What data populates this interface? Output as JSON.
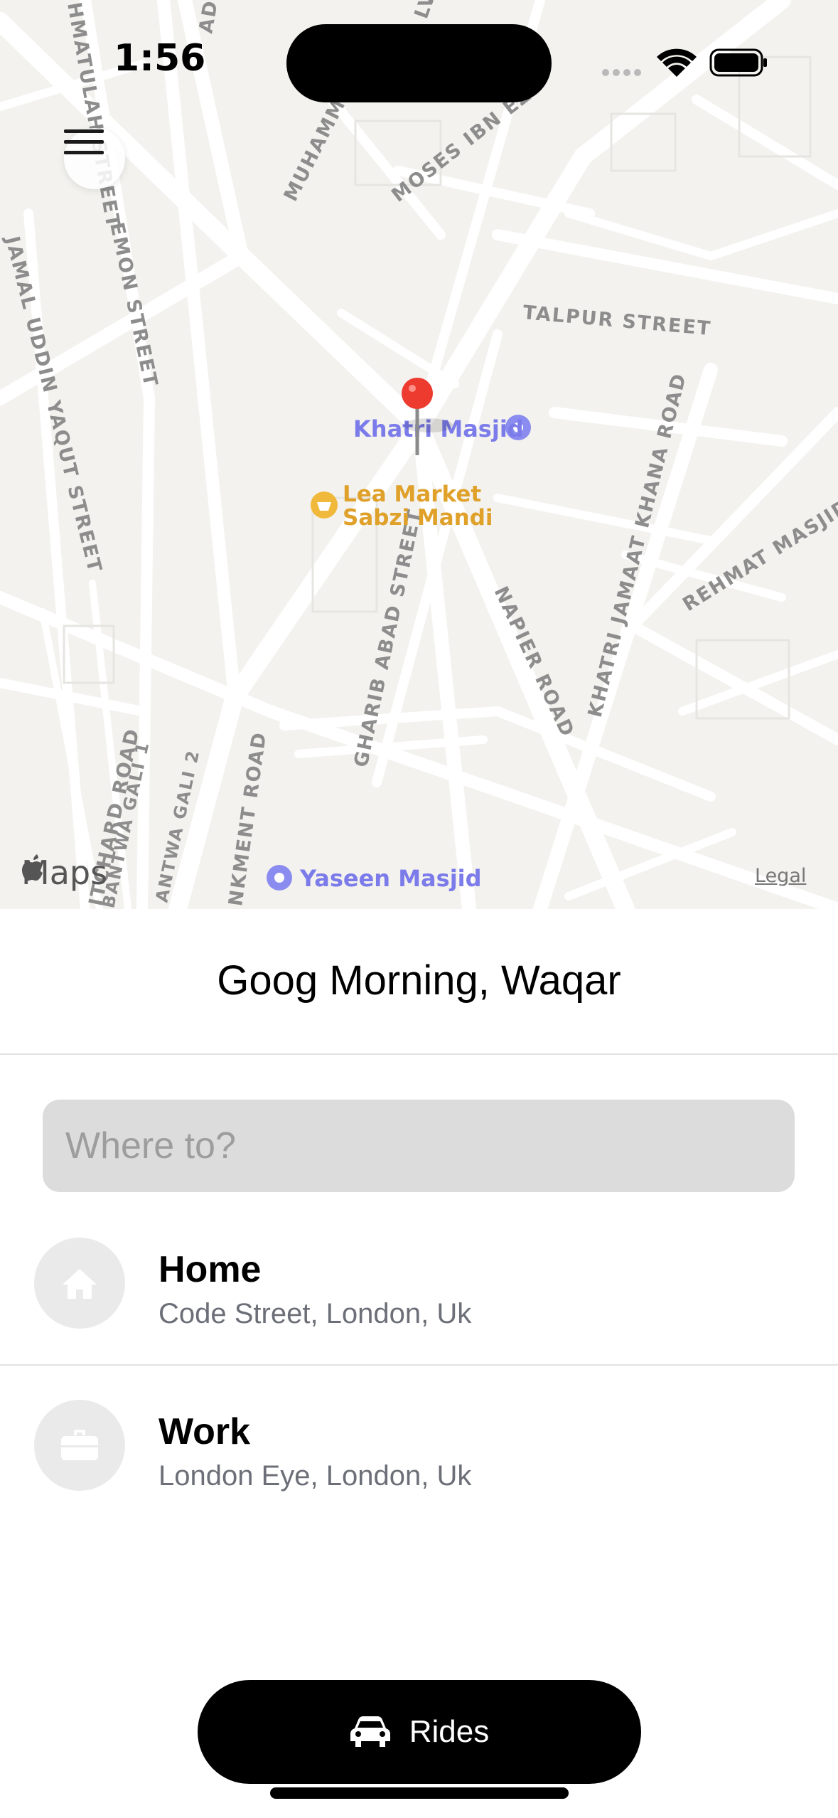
{
  "status_bar": {
    "time": "1:56"
  },
  "map": {
    "streets": [
      "MOSES IBN EZ",
      "TALPUR STREET",
      "KHATRI JAMAAT KHANA ROAD",
      "NAPIER ROAD",
      "GHARIB ABAD STREET",
      "REHMAT MASJID STREE",
      "JAMAL UDDIN YAQUT STREET",
      "EMON STREET",
      "HMATULAH STREET",
      "MUHAMM",
      "ITCHARD ROAD",
      "NKMENT ROAD",
      "BANTWA GALI 1",
      "ANTWA GALI 2",
      "AD",
      "LVA"
    ],
    "pois": {
      "khatri_masjid": "Khatri Masjid",
      "lea_market_line1": "Lea Market",
      "lea_market_line2": "Sabzi Mandi",
      "yaseen_masjid": "Yaseen Masjid"
    },
    "brand": "Maps",
    "legal": "Legal",
    "pin_color": "#ee3b30"
  },
  "greeting": "Goog Morning, Waqar",
  "search": {
    "placeholder": "Where to?"
  },
  "places": [
    {
      "title": "Home",
      "subtitle": "Code Street, London, Uk",
      "icon": "house-icon"
    },
    {
      "title": "Work",
      "subtitle": "London Eye, London, Uk",
      "icon": "briefcase-icon"
    }
  ],
  "rides_button": {
    "label": "Rides",
    "icon": "car-icon"
  }
}
